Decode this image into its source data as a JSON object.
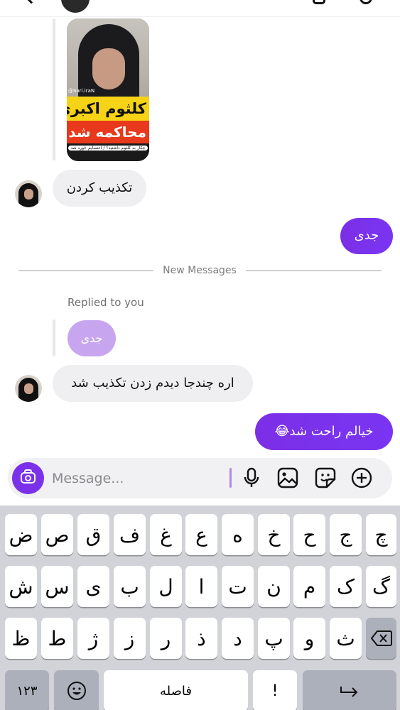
{
  "chat": {
    "media_post": {
      "watermark": "@Sari.iraN",
      "headline_line1": "کلثوم اکبری",
      "headline_line2": "محاکمه شد",
      "caption_small": "چکار به کلثوم داشتید؟ / اعتصابم خورد شد"
    },
    "messages": [
      {
        "id": "m1",
        "direction": "incoming",
        "text": "تکذیب کردن"
      },
      {
        "id": "m2",
        "direction": "outgoing",
        "text": "جدی"
      },
      {
        "id": "m3",
        "direction": "incoming",
        "text": "اره چندجا دیدم زدن تکذیب شد",
        "replied_label": "Replied to you",
        "replied_quote": "جدی"
      },
      {
        "id": "m4",
        "direction": "outgoing",
        "text": "خیالم راحت شد😂"
      }
    ],
    "divider_label": "New Messages"
  },
  "composer": {
    "placeholder": "Message...",
    "value": "",
    "icons": [
      "camera-icon",
      "microphone-icon",
      "gallery-icon",
      "sticker-icon",
      "plus-icon"
    ]
  },
  "keyboard": {
    "row1": [
      "ض",
      "ص",
      "ق",
      "ف",
      "غ",
      "ع",
      "ه",
      "خ",
      "ح",
      "ج",
      "چ"
    ],
    "row2": [
      "ش",
      "س",
      "ی",
      "ب",
      "ل",
      "ا",
      "ت",
      "ن",
      "م",
      "ک",
      "گ"
    ],
    "row3": [
      "ظ",
      "ط",
      "ژ",
      "ز",
      "ر",
      "ذ",
      "د",
      "پ",
      "و",
      "ث"
    ],
    "numbers_key": "۱۲۳",
    "space_key": "فاصله",
    "punct_key": "!",
    "icons": [
      "emoji-icon",
      "backspace-icon",
      "return-icon"
    ]
  },
  "colors": {
    "accent": "#7b2fe6",
    "incoming_bubble": "#efeff1",
    "keyboard_bg": "#d1d3d9"
  }
}
